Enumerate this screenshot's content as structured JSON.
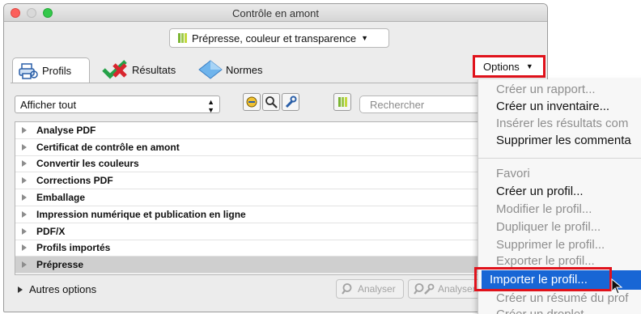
{
  "window": {
    "title": "Contrôle en amont"
  },
  "category_dropdown": {
    "label": "Prépresse, couleur et transparence"
  },
  "tabs": [
    {
      "label": "Profils",
      "icon": "profiles-printer-icon"
    },
    {
      "label": "Résultats",
      "icon": "results-check-icon"
    },
    {
      "label": "Normes",
      "icon": "standards-diamond-icon"
    }
  ],
  "options_button": {
    "label": "Options"
  },
  "filter": {
    "selected": "Afficher tout"
  },
  "search": {
    "placeholder": "Rechercher"
  },
  "profile_groups": [
    "Analyse PDF",
    "Certificat de contrôle en amont",
    "Convertir les couleurs",
    "Corrections PDF",
    "Emballage",
    "Impression numérique et publication en ligne",
    "PDF/X",
    "Profils importés",
    "Prépresse"
  ],
  "more_options": {
    "label": "Autres options"
  },
  "analyze_buttons": [
    "Analyser",
    "Analyser"
  ],
  "options_menu": {
    "items": [
      {
        "label": "Créer un rapport...",
        "state": "disabled"
      },
      {
        "label": "Créer un inventaire...",
        "state": "enabled"
      },
      {
        "label": "Insérer les résultats com",
        "state": "disabled"
      },
      {
        "label": "Supprimer les commenta",
        "state": "enabled"
      },
      {
        "label": "Favori",
        "state": "disabled"
      },
      {
        "label": "Créer un profil...",
        "state": "enabled"
      },
      {
        "label": "Modifier le profil...",
        "state": "disabled"
      },
      {
        "label": "Dupliquer le profil...",
        "state": "disabled"
      },
      {
        "label": "Supprimer le profil...",
        "state": "disabled"
      },
      {
        "label": "Exporter le profil...",
        "state": "disabled"
      },
      {
        "label": "Importer le profil...",
        "state": "selected"
      },
      {
        "label": "Créer un résumé du prof",
        "state": "disabled"
      },
      {
        "label": "Créer un droplet...",
        "state": "disabled"
      }
    ]
  },
  "colors": {
    "highlight_red": "#e0121b",
    "menu_selection_blue": "#1866d5"
  }
}
